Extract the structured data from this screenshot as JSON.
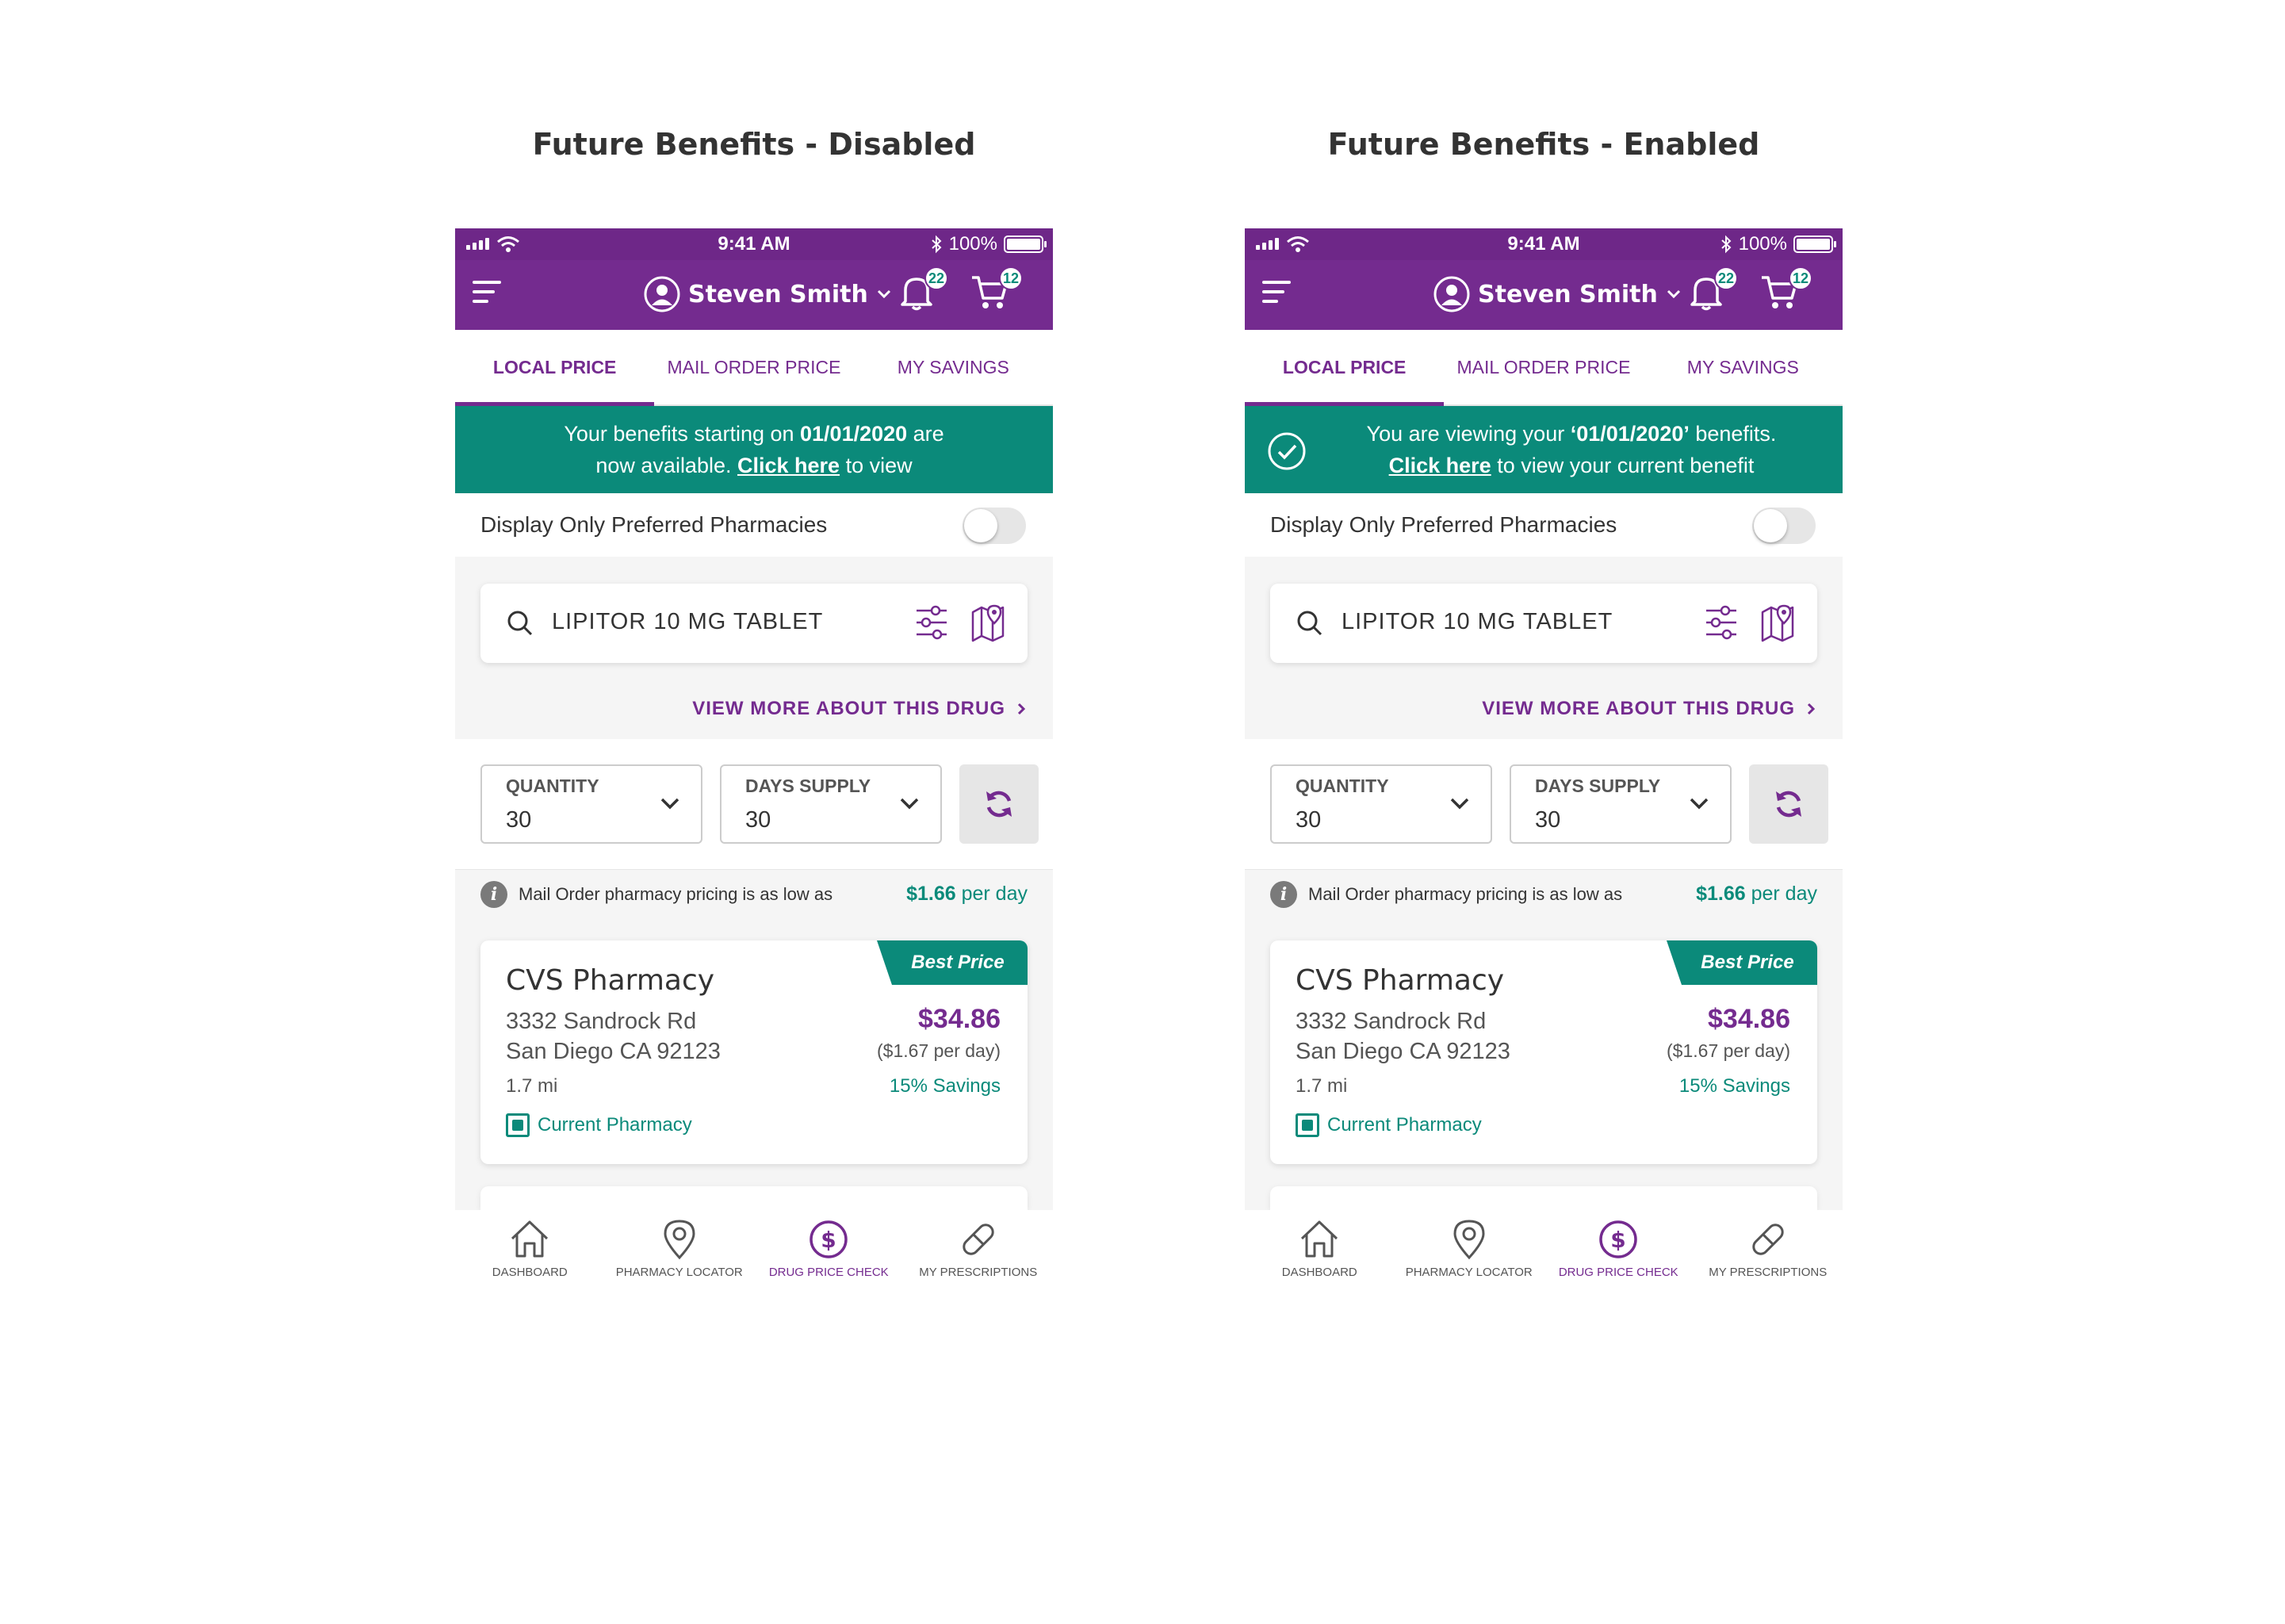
{
  "panels": [
    {
      "title": "Future Benefits - Disabled",
      "status": {
        "time": "9:41 AM",
        "battery": "100%"
      },
      "header": {
        "user_name": "Steven Smith",
        "notifications_count": "22",
        "cart_count": "12"
      },
      "tabs": [
        "LOCAL PRICE",
        "MAIL ORDER PRICE",
        "MY SAVINGS"
      ],
      "banner": {
        "line1_pre": "Your benefits starting on ",
        "line1_bold": "01/01/2020",
        "line1_post": " are",
        "line2_pre": "now available. ",
        "line2_link": "Click here",
        "line2_post": " to view"
      },
      "preferred_label": "Display Only Preferred Pharmacies",
      "search_value": "LIPITOR 10 MG TABLET",
      "view_more": "VIEW MORE ABOUT THIS DRUG",
      "quantity": {
        "label": "QUANTITY",
        "value": "30"
      },
      "days_supply": {
        "label": "DAYS SUPPLY",
        "value": "30"
      },
      "info": {
        "text": "Mail Order pharmacy pricing is as low as",
        "price": "$1.66",
        "unit": " per day"
      },
      "card": {
        "badge": "Best Price",
        "name": "CVS Pharmacy",
        "addr1": "3332 Sandrock Rd",
        "addr2": "San Diego CA 92123",
        "distance": "1.7 mi",
        "current": "Current Pharmacy",
        "price": "$34.86",
        "per_day": "($1.67 per day)",
        "savings": "15% Savings"
      },
      "nav": [
        "DASHBOARD",
        "PHARMACY LOCATOR",
        "DRUG PRICE CHECK",
        "MY PRESCRIPTIONS"
      ]
    },
    {
      "title": "Future Benefits - Enabled",
      "status": {
        "time": "9:41 AM",
        "battery": "100%"
      },
      "header": {
        "user_name": "Steven Smith",
        "notifications_count": "22",
        "cart_count": "12"
      },
      "tabs": [
        "LOCAL PRICE",
        "MAIL ORDER PRICE",
        "MY SAVINGS"
      ],
      "banner": {
        "line1_pre": "You are viewing your ",
        "line1_bold": "‘01/01/2020’",
        "line1_post": " benefits.",
        "line2_pre": "",
        "line2_link": "Click here",
        "line2_post": " to view your current benefit"
      },
      "preferred_label": "Display Only Preferred Pharmacies",
      "search_value": "LIPITOR 10 MG TABLET",
      "view_more": "VIEW MORE ABOUT THIS DRUG",
      "quantity": {
        "label": "QUANTITY",
        "value": "30"
      },
      "days_supply": {
        "label": "DAYS SUPPLY",
        "value": "30"
      },
      "info": {
        "text": "Mail Order pharmacy pricing is as low as",
        "price": "$1.66",
        "unit": " per day"
      },
      "card": {
        "badge": "Best Price",
        "name": "CVS Pharmacy",
        "addr1": "3332 Sandrock Rd",
        "addr2": "San Diego CA 92123",
        "distance": "1.7 mi",
        "current": "Current Pharmacy",
        "price": "$34.86",
        "per_day": "($1.67 per day)",
        "savings": "15% Savings"
      },
      "nav": [
        "DASHBOARD",
        "PHARMACY LOCATOR",
        "DRUG PRICE CHECK",
        "MY PRESCRIPTIONS"
      ]
    }
  ],
  "colors": {
    "brand_purple": "#742b8f",
    "teal": "#0b8a7a"
  },
  "icons": [
    "menu-icon",
    "user-icon",
    "bell-icon",
    "cart-icon",
    "search-icon",
    "filter-icon",
    "map-icon",
    "refresh-icon",
    "info-icon",
    "home-icon",
    "location-pin-icon",
    "dollar-icon",
    "pill-icon",
    "check-circle-icon"
  ]
}
